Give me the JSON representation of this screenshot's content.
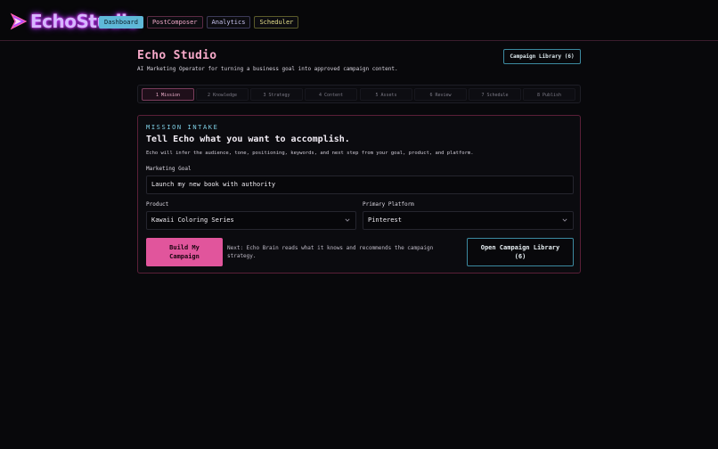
{
  "app": {
    "logo_text": "EchoStudio",
    "accent": "#e1559c",
    "secondary": "#5fb8d8"
  },
  "nav": {
    "items": [
      {
        "label": "Dashboard",
        "active": true
      },
      {
        "label": "PostComposer"
      },
      {
        "label": "Analytics"
      },
      {
        "label": "Scheduler"
      }
    ]
  },
  "header": {
    "title": "Echo Studio",
    "subtitle": "AI Marketing Operator for turning a business goal into approved campaign content.",
    "library_button": "Campaign Library (6)"
  },
  "steps": [
    {
      "label": "1 Mission",
      "active": true
    },
    {
      "label": "2 Knowledge"
    },
    {
      "label": "3 Strategy"
    },
    {
      "label": "4 Content"
    },
    {
      "label": "5 Assets"
    },
    {
      "label": "6 Review"
    },
    {
      "label": "7 Schedule"
    },
    {
      "label": "8 Publish"
    }
  ],
  "intake": {
    "eyebrow": "MISSION INTAKE",
    "title": "Tell Echo what you want to accomplish.",
    "description": "Echo will infer the audience, tone, positioning, keywords, and next step from your goal, product, and platform.",
    "goal_label": "Marketing Goal",
    "goal_value": "Launch my new book with authority",
    "product_label": "Product",
    "product_value": "Kawaii Coloring Series",
    "platform_label": "Primary Platform",
    "platform_value": "Pinterest",
    "build_button": "Build My Campaign",
    "next_text": "Next: Echo Brain reads what it knows and recommends the campaign strategy.",
    "open_library_button": "Open Campaign Library (6)",
    "icons": {
      "select": "chevron-down-icon"
    }
  }
}
